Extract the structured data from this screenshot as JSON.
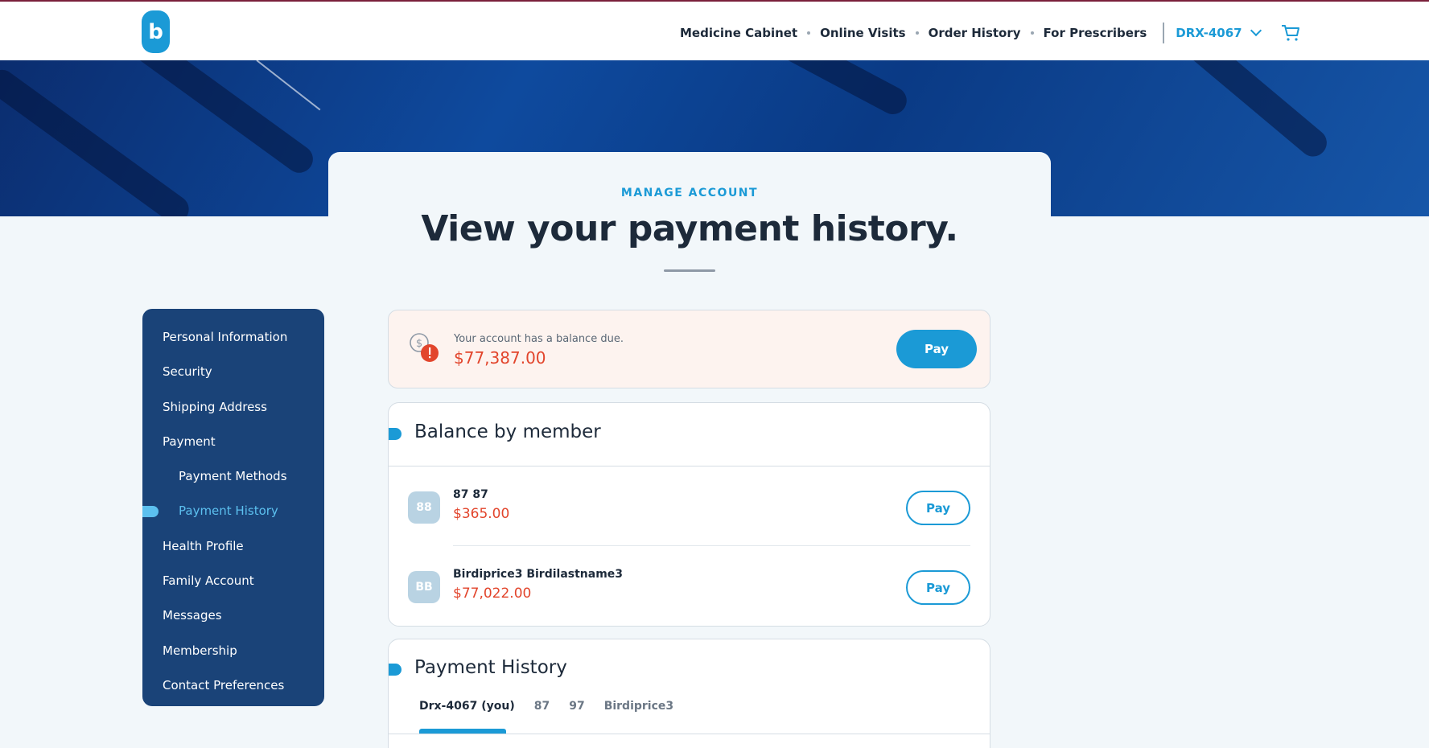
{
  "header": {
    "logo_letter": "b",
    "nav": [
      "Medicine Cabinet",
      "Online Visits",
      "Order History",
      "For Prescribers"
    ],
    "account_label": "DRX-4067"
  },
  "page": {
    "eyebrow": "MANAGE ACCOUNT",
    "title": "View your payment history."
  },
  "sidebar": {
    "items": [
      {
        "label": "Personal Information"
      },
      {
        "label": "Security"
      },
      {
        "label": "Shipping Address"
      },
      {
        "label": "Payment"
      },
      {
        "label": "Payment Methods"
      },
      {
        "label": "Payment History"
      },
      {
        "label": "Health Profile"
      },
      {
        "label": "Family Account"
      },
      {
        "label": "Messages"
      },
      {
        "label": "Membership"
      },
      {
        "label": "Contact Preferences"
      }
    ],
    "active": "Payment History"
  },
  "alert": {
    "message": "Your account has a balance due.",
    "amount": "$77,387.00",
    "pay_label": "Pay"
  },
  "balance_by_member": {
    "title": "Balance by member",
    "members": [
      {
        "initials": "88",
        "name": "87 87",
        "amount": "$365.00",
        "pay_label": "Pay"
      },
      {
        "initials": "BB",
        "name": "Birdiprice3 Birdilastname3",
        "amount": "$77,022.00",
        "pay_label": "Pay"
      }
    ]
  },
  "payment_history": {
    "title": "Payment History",
    "tabs": [
      "Drx-4067 (you)",
      "87",
      "97",
      "Birdiprice3"
    ],
    "active_tab": "Drx-4067 (you)"
  },
  "colors": {
    "accent": "#1b9ad6",
    "sidebar_bg": "#1a4378",
    "amount_red": "#e2452c",
    "alert_bg": "#fdf3ef"
  },
  "icons": [
    "cart-icon",
    "chevron-down-icon",
    "dollar-alert-icon"
  ]
}
